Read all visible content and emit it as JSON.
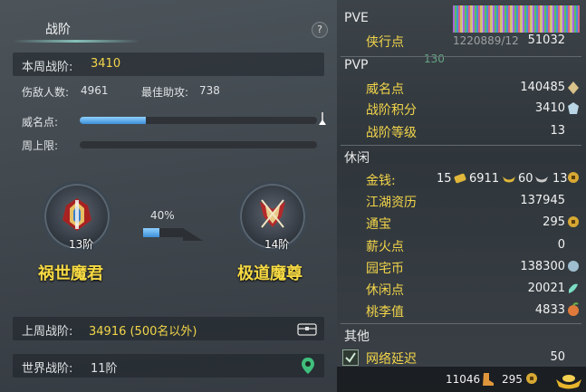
{
  "left": {
    "title": "战阶",
    "help_label": "?",
    "week_rank_label": "本周战阶:",
    "week_rank_value": "3410",
    "injured_label": "伤敌人数:",
    "injured_value": "4961",
    "best_assist_label": "最佳助攻:",
    "best_assist_value": "738",
    "prestige_label": "威名点:",
    "prestige_progress": 0.28,
    "weekly_cap_label": "周上限:",
    "weekly_cap_progress": 0,
    "current_rank_level": "13阶",
    "current_rank_name": "祸世魔君",
    "next_rank_level": "14阶",
    "next_rank_name": "极道魔尊",
    "rank_progress_text": "40%",
    "rank_progress": 0.4,
    "last_week_label": "上周战阶:",
    "last_week_value": "34916 (500名以外)",
    "world_rank_label": "世界战阶:",
    "world_rank_value": "11阶"
  },
  "right": {
    "pve_title": "PVE",
    "pvp_title": "PVP",
    "leisure_title": "休闲",
    "other_title": "其他",
    "overlay_text_1": "1220889/12",
    "overlay_text_2": "130",
    "pve_items": [
      {
        "label": "侠行点",
        "value": "51032"
      }
    ],
    "pvp_items": [
      {
        "label": "威名点",
        "value": "140485"
      },
      {
        "label": "战阶积分",
        "value": "3410"
      },
      {
        "label": "战阶等级",
        "value": "13"
      }
    ],
    "money_label": "金钱:",
    "money_gold": "15",
    "money_silver": "6911",
    "money_copper": "60",
    "money_other": "13",
    "leisure_items": [
      {
        "label": "江湖资历",
        "value": "137945"
      },
      {
        "label": "通宝",
        "value": "295"
      },
      {
        "label": "薪火点",
        "value": "0"
      },
      {
        "label": "园宅币",
        "value": "138300"
      },
      {
        "label": "休闲点",
        "value": "20021"
      },
      {
        "label": "桃李值",
        "value": "4833"
      }
    ],
    "other_items": [
      {
        "label": "网络延迟",
        "value": "50"
      }
    ],
    "bottom_value_1": "11046",
    "bottom_value_2": "295"
  },
  "colors": {
    "accent_yellow": "#f3d54a",
    "bar_blue": "#3d8fd8"
  }
}
